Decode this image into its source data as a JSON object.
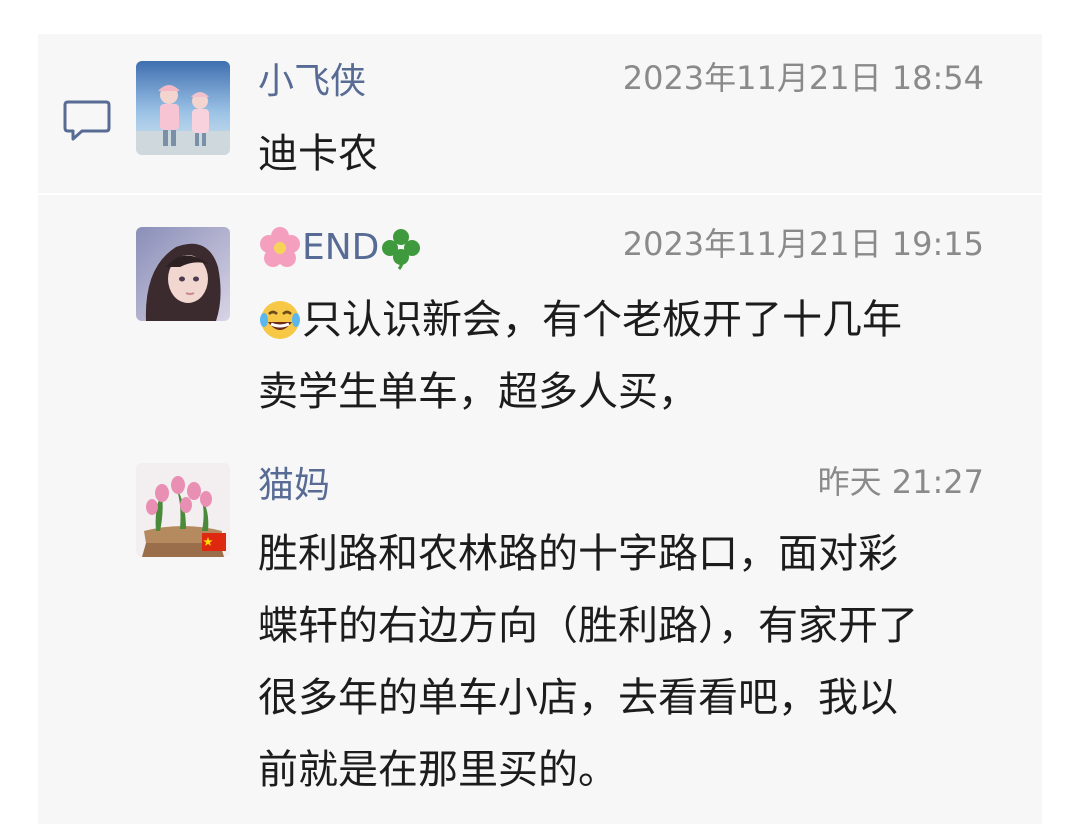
{
  "comments": [
    {
      "author": "小飞侠",
      "time": "2023年11月21日 18:54",
      "text": "迪卡农"
    },
    {
      "author_prefix_icon": "cherry-blossom-icon",
      "author": "END",
      "author_suffix_icon": "four-leaf-clover-icon",
      "time": "2023年11月21日 19:15",
      "text_prefix_icon": "laughing-tears-icon",
      "text_line1": "只认识新会，有个老板开了十几年",
      "text_line2": "卖学生单车，超多人买，"
    },
    {
      "author": "猫妈",
      "time": "昨天 21:27",
      "text_lines": [
        "胜利路和农林路的十字路口，面对彩",
        "蝶轩的右边方向（胜利路），有家开了",
        "很多年的单车小店，去看看吧，我以",
        "前就是在那里买的。"
      ]
    }
  ],
  "colors": {
    "author_name": "#576b95",
    "timestamp": "#8a8a8a",
    "body_text": "#1c1c1c",
    "panel_bg": "#f7f7f7"
  }
}
